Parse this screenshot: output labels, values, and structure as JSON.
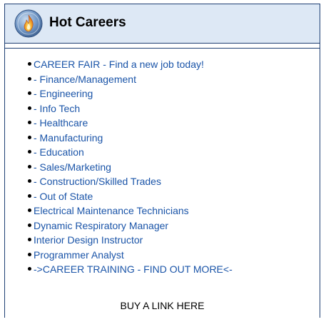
{
  "widget": {
    "title": "Hot Careers",
    "logo_icon": "flame-logo-icon",
    "colors": {
      "header_bg": "#dde8f5",
      "border": "#1f3f73",
      "link": "#1a54a8"
    }
  },
  "links": [
    {
      "label": "CAREER FAIR - Find a new job today!"
    },
    {
      "label": "- Finance/Management"
    },
    {
      "label": "- Engineering"
    },
    {
      "label": "- Info Tech"
    },
    {
      "label": "- Healthcare"
    },
    {
      "label": "- Manufacturing"
    },
    {
      "label": "- Education"
    },
    {
      "label": "- Sales/Marketing"
    },
    {
      "label": "- Construction/Skilled Trades"
    },
    {
      "label": "- Out of State"
    },
    {
      "label": "Electrical Maintenance Technicians"
    },
    {
      "label": "Dynamic Respiratory Manager"
    },
    {
      "label": "Interior Design Instructor"
    },
    {
      "label": "Programmer Analyst"
    },
    {
      "label": "->CAREER TRAINING - FIND OUT MORE<-"
    }
  ],
  "footer": {
    "label": "BUY A LINK HERE"
  }
}
